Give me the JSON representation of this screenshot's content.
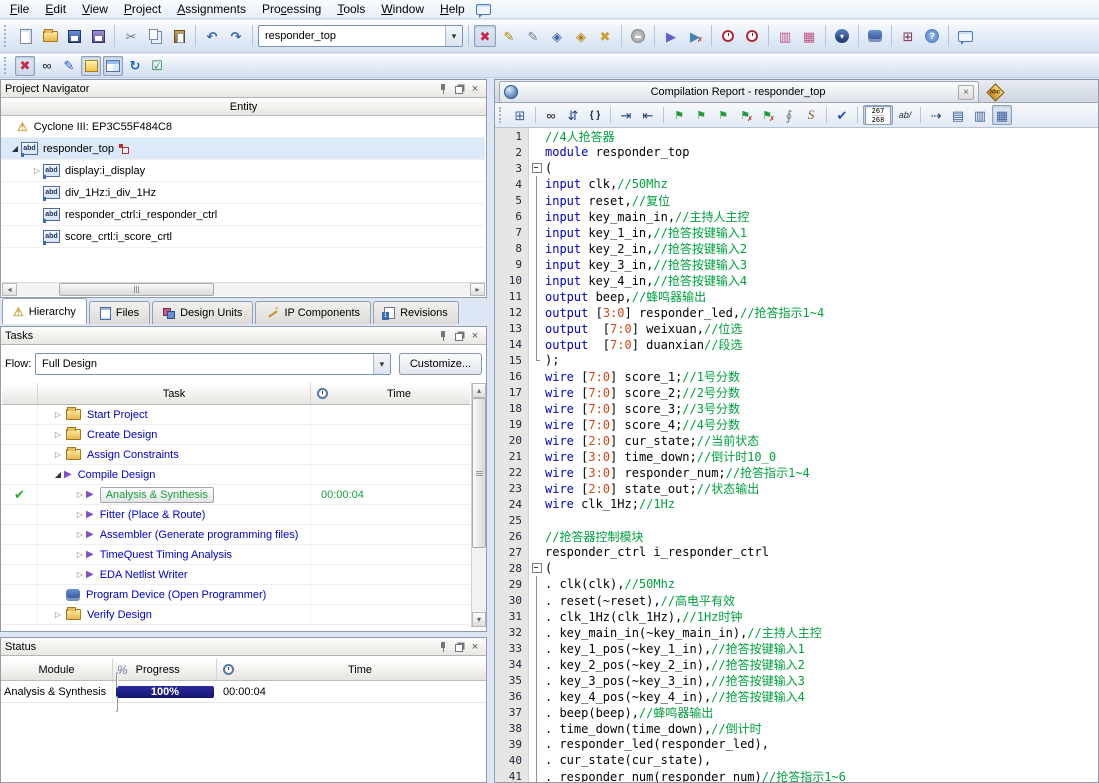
{
  "colors": {
    "keyword": "#0000cd",
    "comment": "#00a03e",
    "number": "#d44a16",
    "success_green": "#18a03c",
    "progress_navy": "#14146e",
    "selection_blue": "#dce9f8"
  },
  "icons": {
    "cut": "✂",
    "undo": "↶",
    "redo": "↷",
    "arrow_down": "▾",
    "settings_star": "✖",
    "pencil": "✎",
    "play": "▶",
    "check": "✔",
    "warning": "⚠",
    "binoculars": "∞",
    "refresh": "↻",
    "checklist": "☑",
    "braces": "{ }",
    "indent": "⇥",
    "unindent": "⇤",
    "flag": "⚑",
    "paperclip": "∮",
    "scroll": "S",
    "expander_closed": "▷",
    "expander_open": "◢",
    "left": "◂",
    "right": "▸",
    "up": "▴",
    "down": "▾",
    "close": "×",
    "replace": "⇵",
    "dotted_arrow": "⇢",
    "blocks1": "▤",
    "blocks2": "▥",
    "blocks3": "▦",
    "grid_plus": "⊞",
    "diamond": "◈",
    "clock": "◷",
    "stamp": "◈"
  },
  "menu": {
    "items": [
      {
        "label": "File",
        "u": 0
      },
      {
        "label": "Edit",
        "u": 0
      },
      {
        "label": "View",
        "u": 0
      },
      {
        "label": "Project",
        "u": 0
      },
      {
        "label": "Assignments",
        "u": 0
      },
      {
        "label": "Processing",
        "u": 3
      },
      {
        "label": "Tools",
        "u": 0
      },
      {
        "label": "Window",
        "u": 0
      },
      {
        "label": "Help",
        "u": 0
      }
    ]
  },
  "toolbar": {
    "revision_value": "responder_top"
  },
  "project_navigator": {
    "title": "Project Navigator",
    "column_header": "Entity",
    "device": "Cyclone III: EP3C55F484C8",
    "entities": [
      {
        "label": "responder_top",
        "level": 0,
        "expand": "expanded",
        "badge": true,
        "selected": true
      },
      {
        "label": "display:i_display",
        "level": 1,
        "expand": "collapsed"
      },
      {
        "label": "div_1Hz:i_div_1Hz",
        "level": 1,
        "expand": "none"
      },
      {
        "label": "responder_ctrl:i_responder_ctrl",
        "level": 1,
        "expand": "none"
      },
      {
        "label": "score_crtl:i_score_crtl",
        "level": 1,
        "expand": "none"
      }
    ]
  },
  "navigator_tabs": {
    "active": "Hierarchy",
    "tabs": [
      {
        "label": "Hierarchy",
        "icon": "hierarchy"
      },
      {
        "label": "Files",
        "icon": "files"
      },
      {
        "label": "Design Units",
        "icon": "design-units"
      },
      {
        "label": "IP Components",
        "icon": "ip-components"
      },
      {
        "label": "Revisions",
        "icon": "revisions"
      }
    ]
  },
  "tasks": {
    "title": "Tasks",
    "flow_label": "Flow:",
    "flow_value": "Full Design",
    "customize_label": "Customize...",
    "col_task": "Task",
    "col_time": "Time",
    "rows": [
      {
        "label": "Start Project",
        "icon": "folder",
        "expand": "collapsed",
        "level": 1,
        "time": ""
      },
      {
        "label": "Create Design",
        "icon": "folder",
        "expand": "collapsed",
        "level": 1,
        "time": ""
      },
      {
        "label": "Assign Constraints",
        "icon": "folder",
        "expand": "collapsed",
        "level": 1,
        "time": ""
      },
      {
        "label": "Compile Design",
        "icon": "play",
        "expand": "expanded",
        "level": 1,
        "time": ""
      },
      {
        "label": "Analysis & Synthesis",
        "icon": "play",
        "expand": "collapsed",
        "level": 2,
        "done": true,
        "selected": true,
        "time": "00:00:04"
      },
      {
        "label": "Fitter (Place & Route)",
        "icon": "play",
        "expand": "collapsed",
        "level": 2,
        "time": ""
      },
      {
        "label": "Assembler (Generate programming files)",
        "icon": "play",
        "expand": "collapsed",
        "level": 2,
        "time": ""
      },
      {
        "label": "TimeQuest Timing Analysis",
        "icon": "play",
        "expand": "collapsed",
        "level": 2,
        "time": ""
      },
      {
        "label": "EDA Netlist Writer",
        "icon": "play",
        "expand": "collapsed",
        "level": 2,
        "time": ""
      },
      {
        "label": "Program Device (Open Programmer)",
        "icon": "hand",
        "expand": "none",
        "level": 1,
        "time": ""
      },
      {
        "label": "Verify Design",
        "icon": "folder",
        "expand": "collapsed",
        "level": 1,
        "time": ""
      }
    ]
  },
  "status_panel": {
    "title": "Status",
    "col_module": "Module",
    "col_percent": "%",
    "col_progress": "Progress",
    "col_time": "Time",
    "rows": [
      {
        "module": "Analysis & Synthesis",
        "progress_label": "100%",
        "progress_value": 100,
        "time": "00:00:04"
      }
    ]
  },
  "editor": {
    "tab_title": "Compilation Report - responder_top",
    "line_indicator_top": "267",
    "line_indicator_bottom": "268",
    "word_wrap_label": "ab/",
    "lines": [
      {
        "n": 1,
        "fold": "",
        "segs": [
          [
            "c",
            "//4人抢答器"
          ]
        ]
      },
      {
        "n": 2,
        "fold": "",
        "segs": [
          [
            "k",
            "module"
          ],
          [
            "p",
            " responder_top"
          ]
        ]
      },
      {
        "n": 3,
        "fold": "start",
        "segs": [
          [
            "p",
            "("
          ]
        ]
      },
      {
        "n": 4,
        "fold": "line",
        "segs": [
          [
            "k",
            "input"
          ],
          [
            "p",
            " clk,"
          ],
          [
            "c",
            "//50Mhz"
          ]
        ]
      },
      {
        "n": 5,
        "fold": "line",
        "segs": [
          [
            "k",
            "input"
          ],
          [
            "p",
            " reset,"
          ],
          [
            "c",
            "//复位"
          ]
        ]
      },
      {
        "n": 6,
        "fold": "line",
        "segs": [
          [
            "k",
            "input"
          ],
          [
            "p",
            " key_main_in,"
          ],
          [
            "c",
            "//主持人主控"
          ]
        ]
      },
      {
        "n": 7,
        "fold": "line",
        "segs": [
          [
            "k",
            "input"
          ],
          [
            "p",
            " key_1_in,"
          ],
          [
            "c",
            "//抢答按键输入1"
          ]
        ]
      },
      {
        "n": 8,
        "fold": "line",
        "segs": [
          [
            "k",
            "input"
          ],
          [
            "p",
            " key_2_in,"
          ],
          [
            "c",
            "//抢答按键输入2"
          ]
        ]
      },
      {
        "n": 9,
        "fold": "line",
        "segs": [
          [
            "k",
            "input"
          ],
          [
            "p",
            " key_3_in,"
          ],
          [
            "c",
            "//抢答按键输入3"
          ]
        ]
      },
      {
        "n": 10,
        "fold": "line",
        "segs": [
          [
            "k",
            "input"
          ],
          [
            "p",
            " key_4_in,"
          ],
          [
            "c",
            "//抢答按键输入4"
          ]
        ]
      },
      {
        "n": 11,
        "fold": "line",
        "segs": [
          [
            "k",
            "output"
          ],
          [
            "p",
            " beep,"
          ],
          [
            "c",
            "//蜂鸣器输出"
          ]
        ]
      },
      {
        "n": 12,
        "fold": "line",
        "segs": [
          [
            "k",
            "output"
          ],
          [
            "p",
            " ["
          ],
          [
            "n",
            "3:0"
          ],
          [
            "p",
            "] responder_led,"
          ],
          [
            "c",
            "//抢答指示1~4"
          ]
        ]
      },
      {
        "n": 13,
        "fold": "line",
        "segs": [
          [
            "k",
            "output"
          ],
          [
            "p",
            "  ["
          ],
          [
            "n",
            "7:0"
          ],
          [
            "p",
            "] weixuan,"
          ],
          [
            "c",
            "//位选"
          ]
        ]
      },
      {
        "n": 14,
        "fold": "line",
        "segs": [
          [
            "k",
            "output"
          ],
          [
            "p",
            "  ["
          ],
          [
            "n",
            "7:0"
          ],
          [
            "p",
            "] duanxian"
          ],
          [
            "c",
            "//段选"
          ]
        ]
      },
      {
        "n": 15,
        "fold": "end",
        "segs": [
          [
            "p",
            ");"
          ]
        ]
      },
      {
        "n": 16,
        "fold": "",
        "segs": [
          [
            "k",
            "wire"
          ],
          [
            "p",
            " ["
          ],
          [
            "n",
            "7:0"
          ],
          [
            "p",
            "] score_1;"
          ],
          [
            "c",
            "//1号分数"
          ]
        ]
      },
      {
        "n": 17,
        "fold": "",
        "segs": [
          [
            "k",
            "wire"
          ],
          [
            "p",
            " ["
          ],
          [
            "n",
            "7:0"
          ],
          [
            "p",
            "] score_2;"
          ],
          [
            "c",
            "//2号分数"
          ]
        ]
      },
      {
        "n": 18,
        "fold": "",
        "segs": [
          [
            "k",
            "wire"
          ],
          [
            "p",
            " ["
          ],
          [
            "n",
            "7:0"
          ],
          [
            "p",
            "] score_3;"
          ],
          [
            "c",
            "//3号分数"
          ]
        ]
      },
      {
        "n": 19,
        "fold": "",
        "segs": [
          [
            "k",
            "wire"
          ],
          [
            "p",
            " ["
          ],
          [
            "n",
            "7:0"
          ],
          [
            "p",
            "] score_4;"
          ],
          [
            "c",
            "//4号分数"
          ]
        ]
      },
      {
        "n": 20,
        "fold": "",
        "segs": [
          [
            "k",
            "wire"
          ],
          [
            "p",
            " ["
          ],
          [
            "n",
            "2:0"
          ],
          [
            "p",
            "] cur_state;"
          ],
          [
            "c",
            "//当前状态"
          ]
        ]
      },
      {
        "n": 21,
        "fold": "",
        "segs": [
          [
            "k",
            "wire"
          ],
          [
            "p",
            " ["
          ],
          [
            "n",
            "3:0"
          ],
          [
            "p",
            "] time_down;"
          ],
          [
            "c",
            "//倒计时10_0"
          ]
        ]
      },
      {
        "n": 22,
        "fold": "",
        "segs": [
          [
            "k",
            "wire"
          ],
          [
            "p",
            " ["
          ],
          [
            "n",
            "3:0"
          ],
          [
            "p",
            "] responder_num;"
          ],
          [
            "c",
            "//抢答指示1~4"
          ]
        ]
      },
      {
        "n": 23,
        "fold": "",
        "segs": [
          [
            "k",
            "wire"
          ],
          [
            "p",
            " ["
          ],
          [
            "n",
            "2:0"
          ],
          [
            "p",
            "] state_out;"
          ],
          [
            "c",
            "//状态输出"
          ]
        ]
      },
      {
        "n": 24,
        "fold": "",
        "segs": [
          [
            "k",
            "wire"
          ],
          [
            "p",
            " clk_1Hz;"
          ],
          [
            "c",
            "//1Hz"
          ]
        ]
      },
      {
        "n": 25,
        "fold": "",
        "segs": []
      },
      {
        "n": 26,
        "fold": "",
        "segs": [
          [
            "c",
            "//抢答器控制模块"
          ]
        ]
      },
      {
        "n": 27,
        "fold": "",
        "segs": [
          [
            "p",
            "responder_ctrl i_responder_ctrl"
          ]
        ]
      },
      {
        "n": 28,
        "fold": "start",
        "segs": [
          [
            "p",
            "("
          ]
        ]
      },
      {
        "n": 29,
        "fold": "line",
        "segs": [
          [
            "p",
            ". clk(clk),"
          ],
          [
            "c",
            "//50Mhz"
          ]
        ]
      },
      {
        "n": 30,
        "fold": "line",
        "segs": [
          [
            "p",
            ". reset(~reset),"
          ],
          [
            "c",
            "//高电平有效"
          ]
        ]
      },
      {
        "n": 31,
        "fold": "line",
        "segs": [
          [
            "p",
            ". clk_1Hz(clk_1Hz),"
          ],
          [
            "c",
            "//1Hz时钟"
          ]
        ]
      },
      {
        "n": 32,
        "fold": "line",
        "segs": [
          [
            "p",
            ". key_main_in(~key_main_in),"
          ],
          [
            "c",
            "//主持人主控"
          ]
        ]
      },
      {
        "n": 33,
        "fold": "line",
        "segs": [
          [
            "p",
            ". key_1_pos(~key_1_in),"
          ],
          [
            "c",
            "//抢答按键输入1"
          ]
        ]
      },
      {
        "n": 34,
        "fold": "line",
        "segs": [
          [
            "p",
            ". key_2_pos(~key_2_in),"
          ],
          [
            "c",
            "//抢答按键输入2"
          ]
        ]
      },
      {
        "n": 35,
        "fold": "line",
        "segs": [
          [
            "p",
            ". key_3_pos(~key_3_in),"
          ],
          [
            "c",
            "//抢答按键输入3"
          ]
        ]
      },
      {
        "n": 36,
        "fold": "line",
        "segs": [
          [
            "p",
            ". key_4_pos(~key_4_in),"
          ],
          [
            "c",
            "//抢答按键输入4"
          ]
        ]
      },
      {
        "n": 37,
        "fold": "line",
        "segs": [
          [
            "p",
            ". beep(beep),"
          ],
          [
            "c",
            "//蜂鸣器输出"
          ]
        ]
      },
      {
        "n": 38,
        "fold": "line",
        "segs": [
          [
            "p",
            ". time_down(time_down),"
          ],
          [
            "c",
            "//倒计时"
          ]
        ]
      },
      {
        "n": 39,
        "fold": "line",
        "segs": [
          [
            "p",
            ". responder_led(responder_led),"
          ]
        ]
      },
      {
        "n": 40,
        "fold": "line",
        "segs": [
          [
            "p",
            ". cur_state(cur_state),"
          ]
        ]
      },
      {
        "n": 41,
        "fold": "line",
        "segs": [
          [
            "p",
            ". responder_num(responder_num)"
          ],
          [
            "c",
            "//抢答指示1~6"
          ]
        ]
      }
    ]
  }
}
